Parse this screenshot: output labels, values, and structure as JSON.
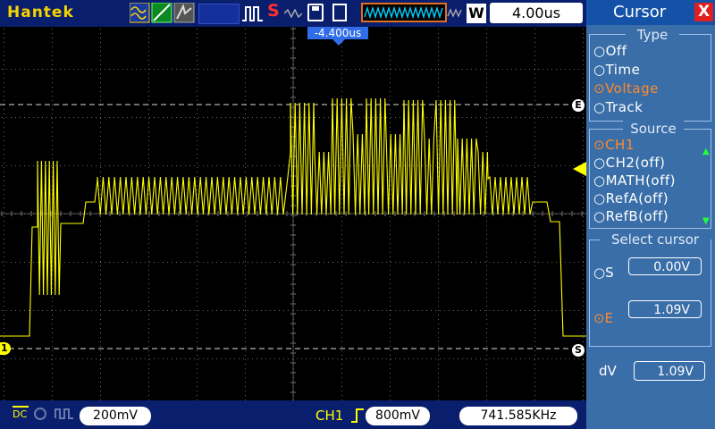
{
  "brand": "Hantek",
  "toolbar": {
    "timebase": "4.00us",
    "trigger_pos": "-4.400us",
    "w_label": "W",
    "icons": [
      "waveform-mode-icon",
      "line-icon",
      "persistence-icon",
      "display-mode-box",
      "run-pulse-icon",
      "stop-icon",
      "save-disk-icon",
      "file-icon",
      "waveform-view-icon",
      "wide-window-icon"
    ]
  },
  "bottom": {
    "ch1_coupling": "DC",
    "volts_div": "200mV",
    "trigger_source": "CH1",
    "trigger_level": "800mV",
    "frequency": "741.585KHz"
  },
  "markers": {
    "channel": "1",
    "cursor_e": "E",
    "cursor_s": "S"
  },
  "panel": {
    "title": "Cursor",
    "close": "X",
    "type_title": "Type",
    "type_options": [
      "Off",
      "Time",
      "Voltage",
      "Track"
    ],
    "type_selected": "Voltage",
    "source_title": "Source",
    "source_options": [
      "CH1",
      "CH2(off)",
      "MATH(off)",
      "RefA(off)",
      "RefB(off)"
    ],
    "source_selected": "CH1",
    "select_title": "Select cursor",
    "cursor_s_label": "S",
    "cursor_s_value": "0.00V",
    "cursor_e_label": "E",
    "cursor_e_value": "1.09V",
    "dv_label": "dV",
    "dv_value": "1.09V"
  },
  "colors": {
    "trace": "#ffff00",
    "selected_option": "#ff8a2a",
    "stop": "#ff3030"
  }
}
